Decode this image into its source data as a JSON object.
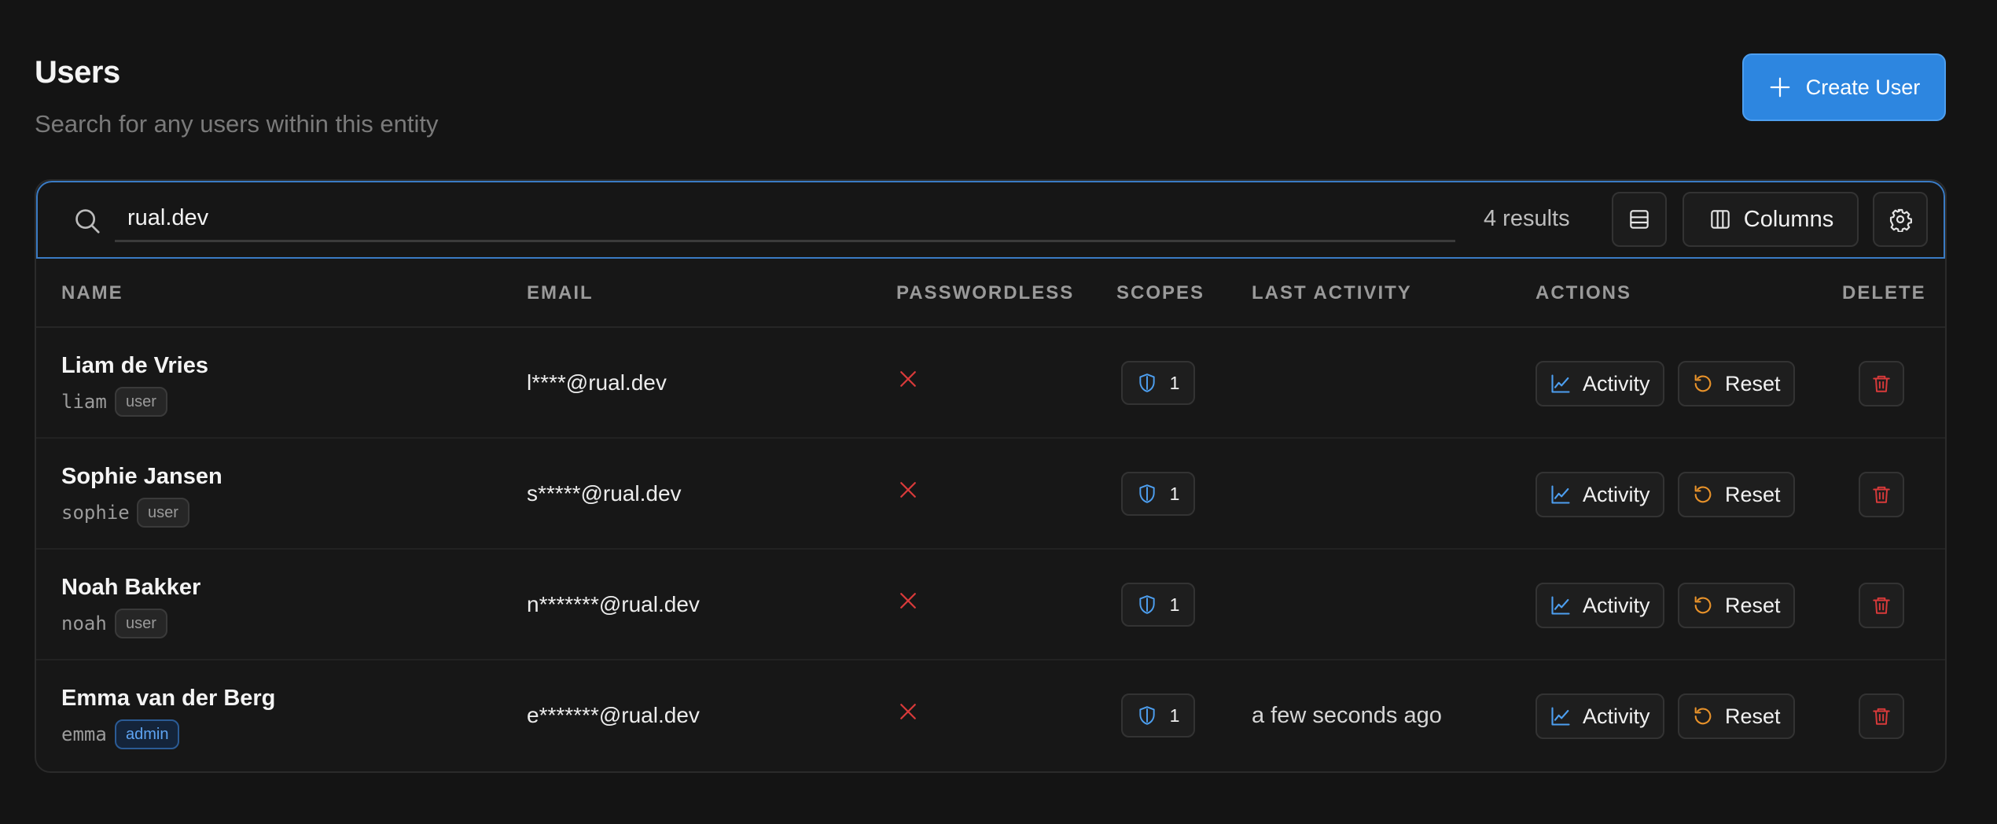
{
  "header": {
    "title": "Users",
    "subtitle": "Search for any users within this entity",
    "create_button_label": "Create User"
  },
  "search": {
    "value": "rual.dev",
    "results_text": "4 results",
    "columns_label": "Columns"
  },
  "table": {
    "headers": {
      "name": "NAME",
      "email": "EMAIL",
      "passwordless": "PASSWORDLESS",
      "scopes": "SCOPES",
      "last_activity": "LAST ACTIVITY",
      "actions": "ACTIONS",
      "delete": "DELETE"
    },
    "rows": [
      {
        "name": "Liam de Vries",
        "username": "liam",
        "role": "user",
        "email": "l****@rual.dev",
        "passwordless": false,
        "scopes": "1",
        "last_activity": "",
        "activity_label": "Activity",
        "reset_label": "Reset"
      },
      {
        "name": "Sophie Jansen",
        "username": "sophie",
        "role": "user",
        "email": "s*****@rual.dev",
        "passwordless": false,
        "scopes": "1",
        "last_activity": "",
        "activity_label": "Activity",
        "reset_label": "Reset"
      },
      {
        "name": "Noah Bakker",
        "username": "noah",
        "role": "user",
        "email": "n*******@rual.dev",
        "passwordless": false,
        "scopes": "1",
        "last_activity": "",
        "activity_label": "Activity",
        "reset_label": "Reset"
      },
      {
        "name": "Emma van der Berg",
        "username": "emma",
        "role": "admin",
        "email": "e*******@rual.dev",
        "passwordless": false,
        "scopes": "1",
        "last_activity": "a few seconds ago",
        "activity_label": "Activity",
        "reset_label": "Reset"
      }
    ]
  },
  "colors": {
    "background": "#141414",
    "accent": "#2d86e0",
    "danger": "#d93a3a",
    "warning": "#e8922a",
    "admin_badge": "#5ea4f2"
  },
  "icons": {
    "search": "search-icon",
    "create": "plus-icon",
    "density": "rows-icon",
    "columns": "columns-icon",
    "settings": "gear-icon",
    "passwordless_false": "x-icon",
    "scope": "shield-icon",
    "activity": "chart-line-icon",
    "reset": "reset-icon",
    "delete": "trash-icon"
  }
}
